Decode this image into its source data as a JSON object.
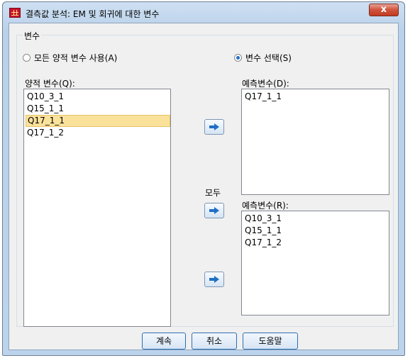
{
  "window": {
    "title": "결측값 분석: EM 및 회귀에 대한 변수",
    "close_glyph": "x"
  },
  "group": {
    "label": "변수",
    "radio_all": "모든 양적 변수 사용(A)",
    "radio_select": "변수 선택(S)"
  },
  "quantitative": {
    "label": "양적 변수(Q):",
    "items": [
      "Q10_3_1",
      "Q15_1_1",
      "Q17_1_1",
      "Q17_1_2"
    ],
    "selected_index": 2
  },
  "predicted": {
    "label": "예측변수(D):",
    "items": [
      "Q17_1_1"
    ]
  },
  "predictors": {
    "all_label": "모두",
    "label": "예측변수(R):",
    "items": [
      "Q10_3_1",
      "Q15_1_1",
      "Q17_1_2"
    ]
  },
  "buttons": {
    "continue": "계속",
    "cancel": "취소",
    "help": "도움말"
  },
  "colors": {
    "selection": "#fbe29b",
    "arrow": "#1f6fc5",
    "close": "#c8432b"
  }
}
